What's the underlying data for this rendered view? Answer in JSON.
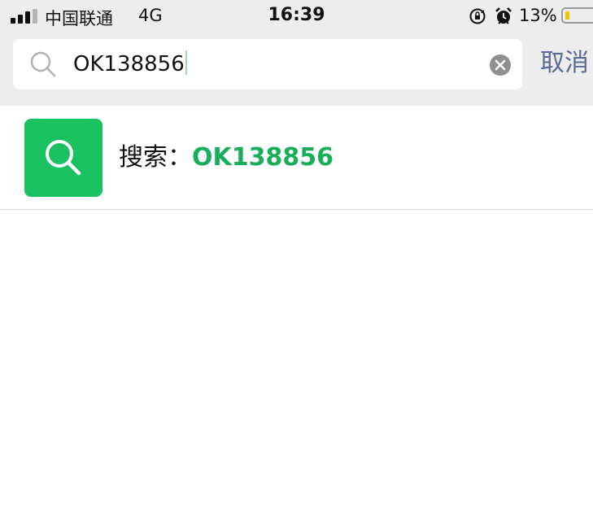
{
  "status_bar": {
    "carrier": "中国联通",
    "network": "4G",
    "time": "16:39",
    "battery_percent": "13%",
    "battery_level": 0.13,
    "icons": [
      "signal-icon",
      "rotation-lock-icon",
      "alarm-icon",
      "battery-icon"
    ]
  },
  "search": {
    "query": "OK138856",
    "icon": "search-icon",
    "clear_icon": "clear-icon",
    "cancel_label": "取消"
  },
  "results": {
    "prefix": "搜索：",
    "query": "OK138856",
    "tile_color": "#19c160",
    "query_color": "#1aad5c"
  },
  "colors": {
    "accent": "#19c160",
    "link": "#576b95",
    "topbar_bg": "#ededed"
  }
}
